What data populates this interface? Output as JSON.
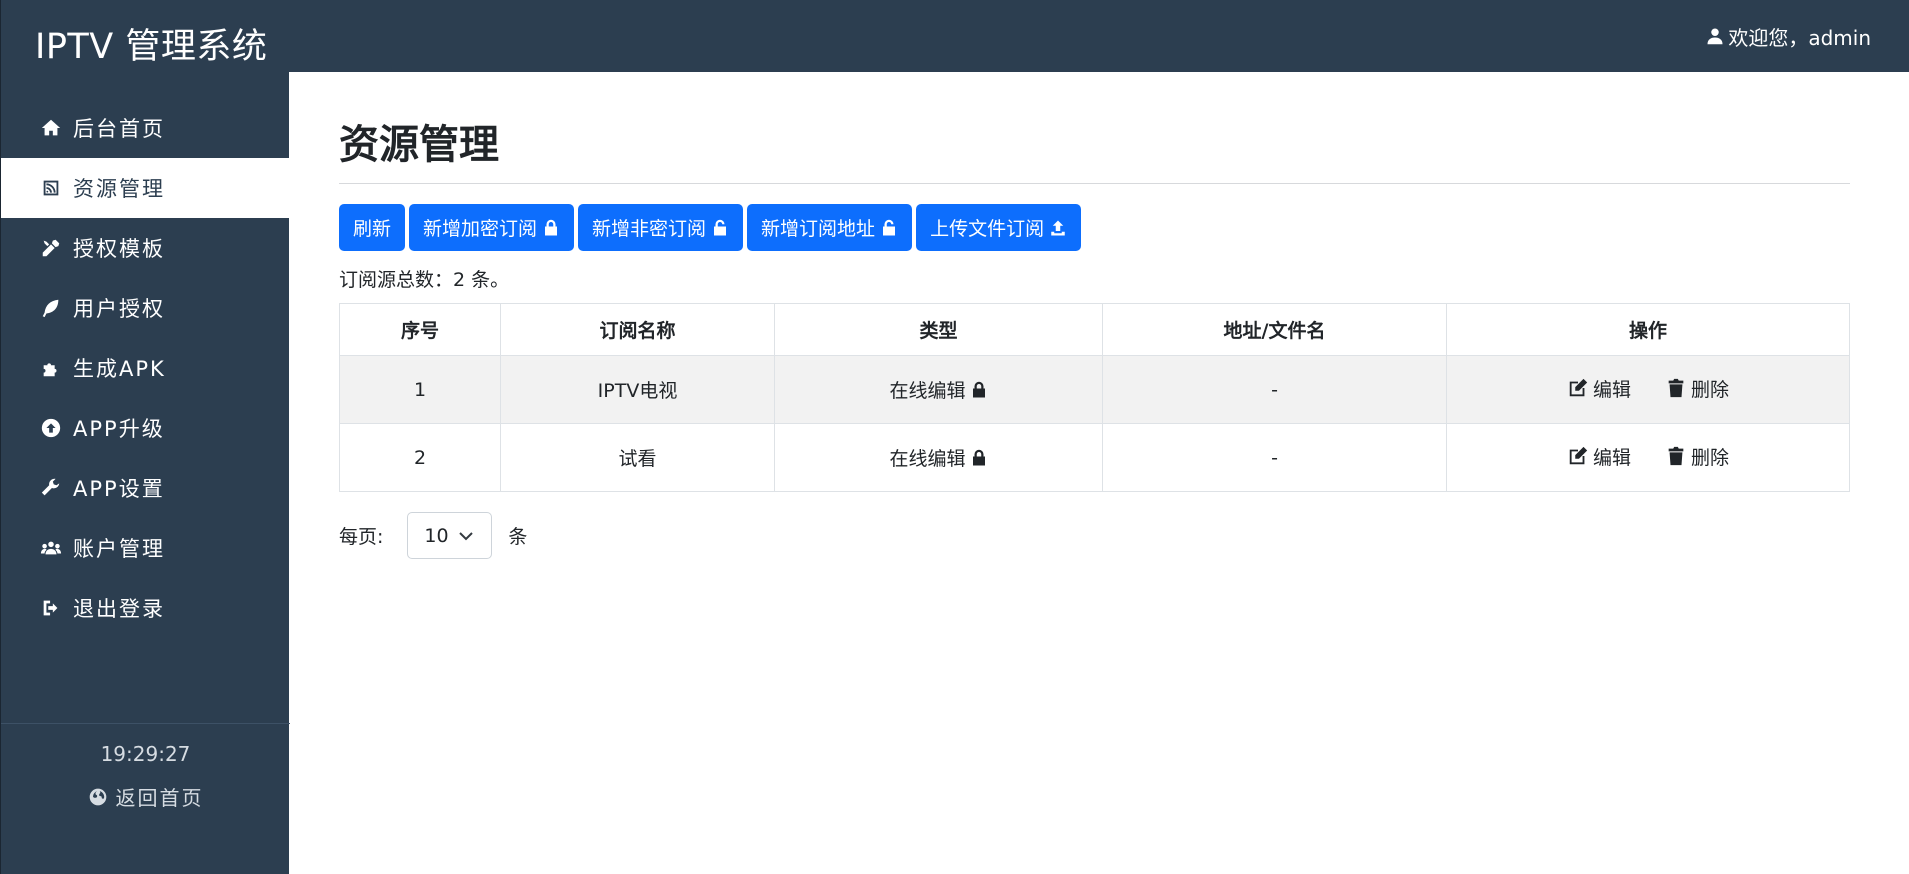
{
  "app": {
    "title": "IPTV 管理系统"
  },
  "sidebar": {
    "items": [
      {
        "label": "后台首页",
        "icon": "home-icon"
      },
      {
        "label": "资源管理",
        "icon": "rss-icon",
        "active": true
      },
      {
        "label": "授权模板",
        "icon": "tools-icon"
      },
      {
        "label": "用户授权",
        "icon": "feather-icon"
      },
      {
        "label": "生成APK",
        "icon": "puzzle-icon"
      },
      {
        "label": "APP升级",
        "icon": "upgrade-icon"
      },
      {
        "label": "APP设置",
        "icon": "wrench-icon"
      },
      {
        "label": "账户管理",
        "icon": "users-icon"
      },
      {
        "label": "退出登录",
        "icon": "logout-icon"
      }
    ],
    "clock": "19:29:27",
    "back_home": "返回首页"
  },
  "header": {
    "welcome": "欢迎您，admin"
  },
  "main": {
    "title": "资源管理",
    "buttons": {
      "refresh": "刷新",
      "add_encrypted": "新增加密订阅",
      "add_plain": "新增非密订阅",
      "add_url": "新增订阅地址",
      "upload_file": "上传文件订阅"
    },
    "total": "订阅源总数：2 条。",
    "table": {
      "headers": [
        "序号",
        "订阅名称",
        "类型",
        "地址/文件名",
        "操作"
      ],
      "rows": [
        {
          "index": "1",
          "name": "IPTV电视",
          "type": "在线编辑",
          "address": "-",
          "edit": "编辑",
          "delete": "删除"
        },
        {
          "index": "2",
          "name": "试看",
          "type": "在线编辑",
          "address": "-",
          "edit": "编辑",
          "delete": "删除"
        }
      ]
    },
    "pager": {
      "prefix": "每页:",
      "value": "10",
      "suffix": "条"
    }
  },
  "colors": {
    "sidebar": "#2c3e50",
    "primary": "#0d6efd"
  }
}
